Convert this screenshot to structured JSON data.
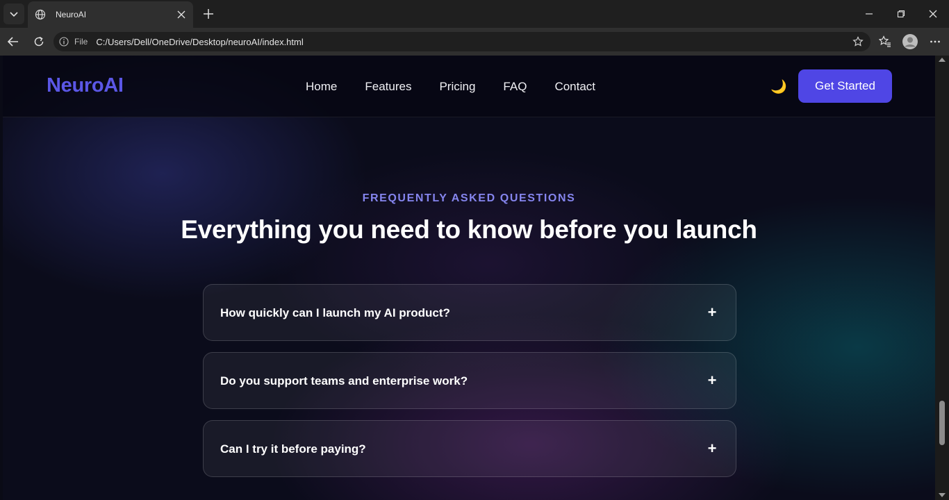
{
  "browser": {
    "tab_title": "NeuroAI",
    "url_scheme_label": "File",
    "url": "C:/Users/Dell/OneDrive/Desktop/neuroAI/index.html"
  },
  "nav": {
    "logo": "NeuroAI",
    "links": [
      "Home",
      "Features",
      "Pricing",
      "FAQ",
      "Contact"
    ],
    "theme_toggle": "🌙",
    "cta": "Get Started"
  },
  "faq": {
    "eyebrow": "FREQUENTLY ASKED QUESTIONS",
    "title": "Everything you need to know before you launch",
    "items": [
      {
        "question": "How quickly can I launch my AI product?",
        "toggle": "+"
      },
      {
        "question": "Do you support teams and enterprise work?",
        "toggle": "+"
      },
      {
        "question": "Can I try it before paying?",
        "toggle": "+"
      }
    ]
  },
  "colors": {
    "brand": "#5b57e6",
    "cta_bg": "#4f46e5",
    "eyebrow": "#8585ee",
    "background": "#0b0c1b"
  }
}
